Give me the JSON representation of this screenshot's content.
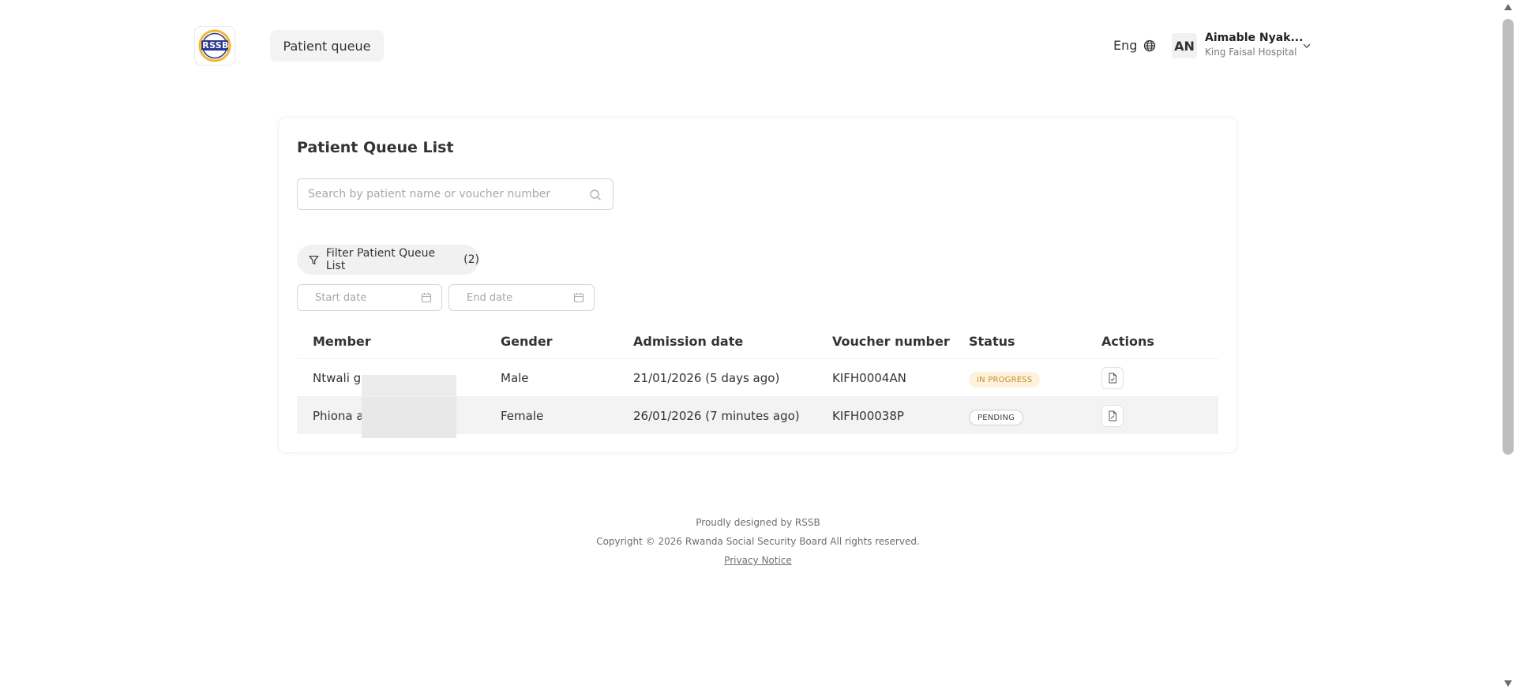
{
  "header": {
    "logo_text": "RSSB",
    "nav_label": "Patient queue",
    "language": "Eng",
    "user": {
      "initials": "AN",
      "name": "Aimable Nyak...",
      "hospital": "King Faisal Hospital"
    }
  },
  "main": {
    "title": "Patient Queue List",
    "search_placeholder": "Search by patient name or voucher number",
    "filter_label": "Filter Patient Queue List",
    "filter_count": "(2)",
    "start_date_placeholder": "Start date",
    "end_date_placeholder": "End date",
    "columns": [
      "Member",
      "Gender",
      "Admission date",
      "Voucher number",
      "Status",
      "Actions"
    ],
    "rows": [
      {
        "member": "Ntwali ga",
        "gender": "Male",
        "admission": "21/01/2026 (5 days ago)",
        "voucher": "KIFH0004AN",
        "status": "IN PROGRESS"
      },
      {
        "member": "Phiona ar",
        "gender": "Female",
        "admission": "26/01/2026 (7 minutes ago)",
        "voucher": "KIFH00038P",
        "status": "PENDING"
      }
    ]
  },
  "footer": {
    "designed": "Proudly designed by RSSB",
    "copyright": "Copyright © 2026 Rwanda Social Security Board All rights reserved.",
    "privacy": "Privacy Notice"
  },
  "colors": {
    "in_progress_bg": "#fff2dc",
    "in_progress_text": "#c58a2c",
    "logo_blue": "#2b3990",
    "logo_gold": "#f2b632"
  }
}
